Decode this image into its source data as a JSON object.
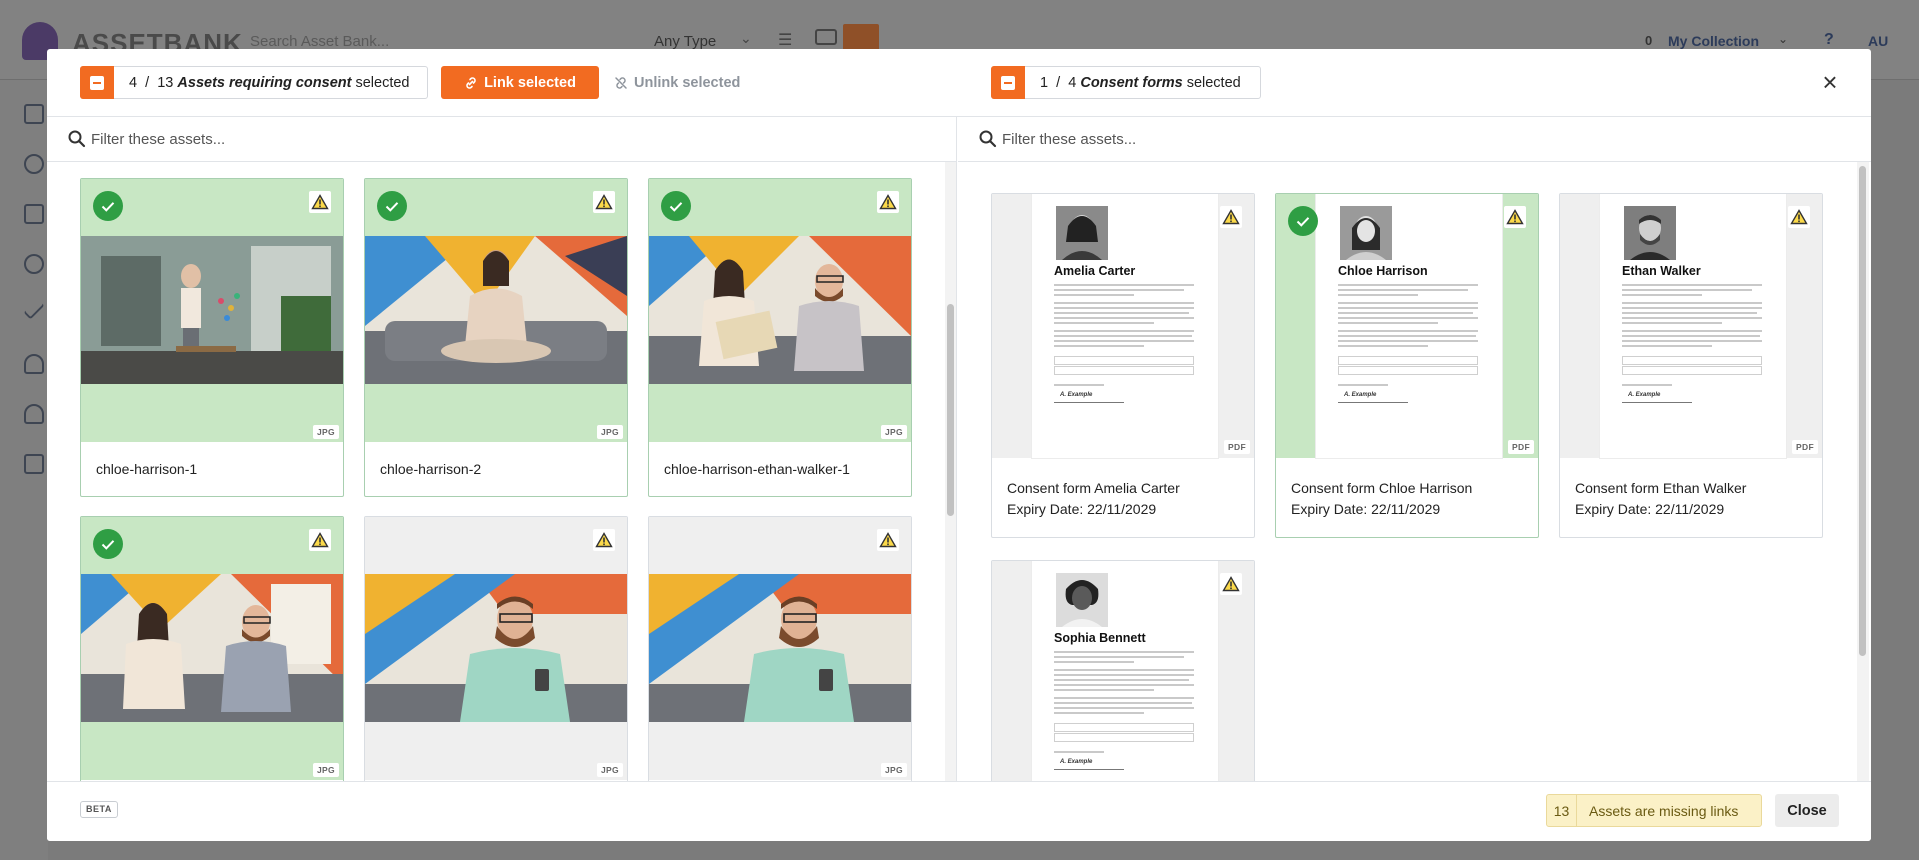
{
  "app": {
    "logo_text": "ASSETBANK",
    "search_placeholder": "Search Asset Bank...",
    "type_filter": "Any Type",
    "collection_count": "0",
    "collection_label": "My Collection",
    "help": "?",
    "user_initials": "AU"
  },
  "header": {
    "assets_selected": "4",
    "assets_total": "13",
    "assets_label": "Assets requiring consent",
    "selected_word": "selected",
    "link_label": "Link selected",
    "unlink_label": "Unlink selected",
    "forms_selected": "1",
    "forms_total": "4",
    "forms_label": "Consent forms",
    "separator": "/"
  },
  "left_panel": {
    "filter_placeholder": "Filter these assets...",
    "assets": [
      {
        "name": "chloe-harrison-1",
        "type": "JPG",
        "selected": true
      },
      {
        "name": "chloe-harrison-2",
        "type": "JPG",
        "selected": true
      },
      {
        "name": "chloe-harrison-ethan-walker-1",
        "type": "JPG",
        "selected": true
      },
      {
        "name": "",
        "type": "JPG",
        "selected": true
      },
      {
        "name": "",
        "type": "JPG",
        "selected": false
      },
      {
        "name": "",
        "type": "JPG",
        "selected": false
      }
    ]
  },
  "right_panel": {
    "filter_placeholder": "Filter these assets...",
    "forms": [
      {
        "person": "Amelia Carter",
        "title": "Consent form Amelia Carter",
        "expiry": "Expiry Date: 22/11/2029",
        "type": "PDF",
        "selected": false,
        "signature": "A. Example"
      },
      {
        "person": "Chloe Harrison",
        "title": "Consent form Chloe Harrison",
        "expiry": "Expiry Date: 22/11/2029",
        "type": "PDF",
        "selected": true,
        "signature": "A. Example"
      },
      {
        "person": "Ethan Walker",
        "title": "Consent form Ethan Walker",
        "expiry": "Expiry Date: 22/11/2029",
        "type": "PDF",
        "selected": false,
        "signature": "A. Example"
      },
      {
        "person": "Sophia Bennett",
        "title": "",
        "expiry": "",
        "type": "",
        "selected": false,
        "signature": "A. Example"
      }
    ]
  },
  "footer": {
    "beta": "BETA",
    "missing_count": "13",
    "missing_label": "Assets are missing links",
    "close_label": "Close"
  },
  "colors": {
    "accent": "#f26b21",
    "selected_bg": "#c8e7c4",
    "check_green": "#2f9e44",
    "warning_yellow": "#fbf1c7"
  },
  "icons": [
    "minus-checkbox-icon",
    "link-icon",
    "unlink-icon",
    "close-icon",
    "search-icon",
    "check-icon",
    "warning-icon"
  ]
}
